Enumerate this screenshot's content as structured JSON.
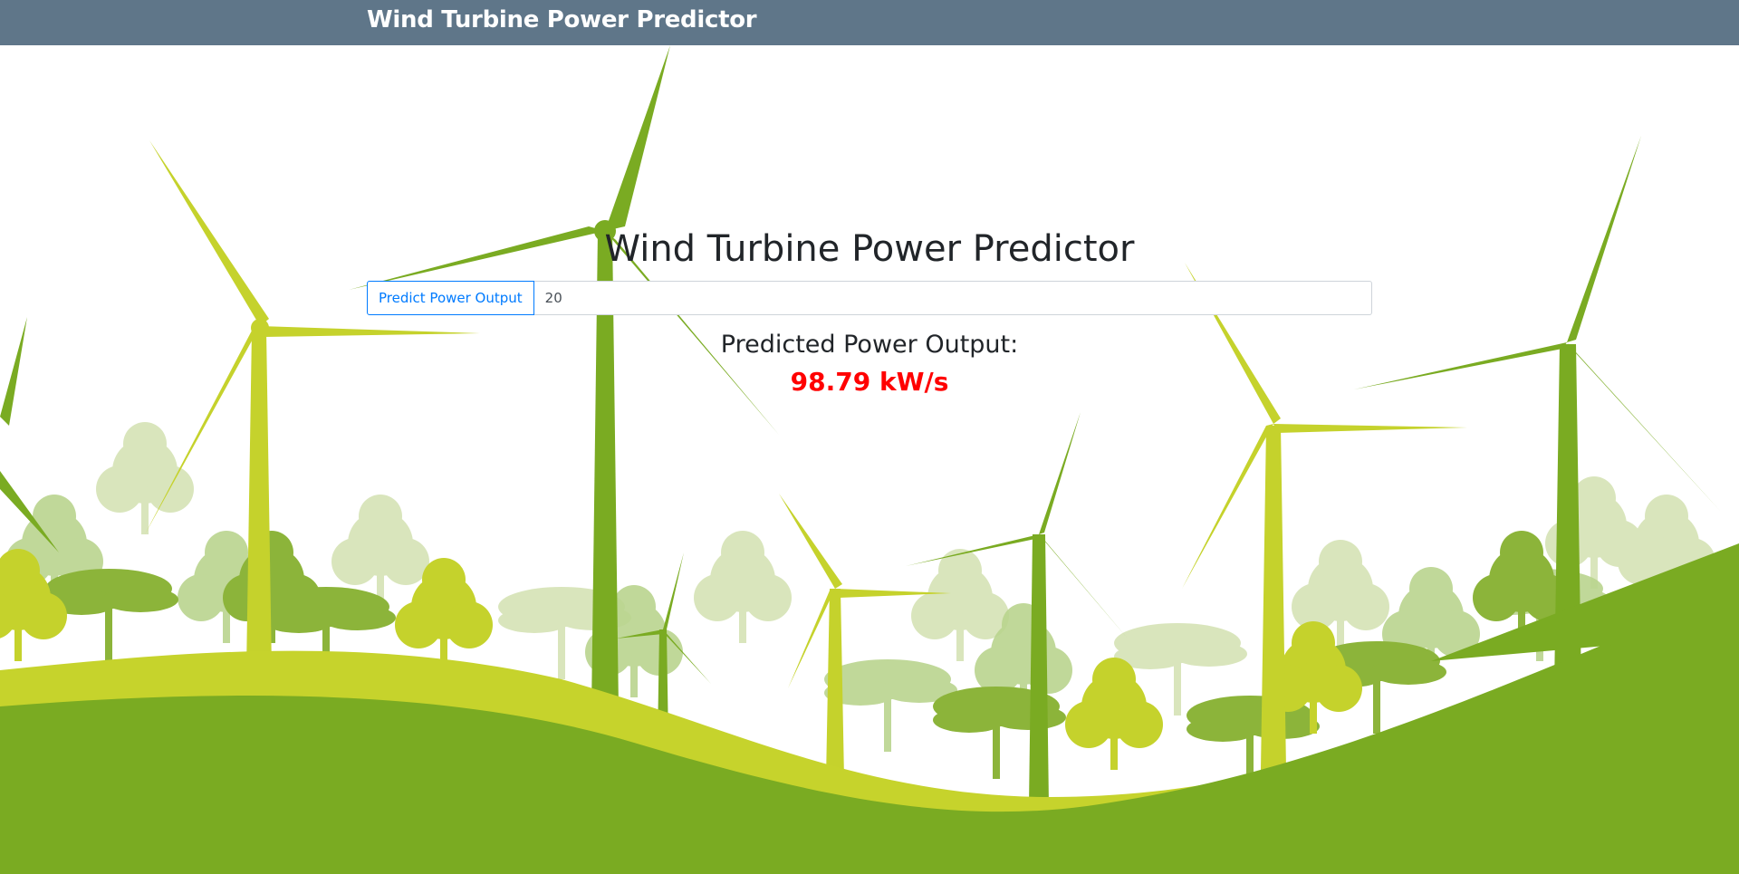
{
  "navbar": {
    "brand": "Wind Turbine Power Predictor"
  },
  "main": {
    "title": "Wind Turbine Power Predictor",
    "predict_button_label": "Predict Power Output",
    "wind_speed_value": "20",
    "result_label": "Predicted Power Output:",
    "result_value": "98.79 kW/s"
  },
  "colors": {
    "navbar": "#5f7689",
    "accent": "#007bff",
    "result": "#ff0000",
    "hill_dark": "#7aab22",
    "hill_light": "#c6d32c"
  },
  "background": {
    "illustration": "wind-turbines-and-trees"
  }
}
